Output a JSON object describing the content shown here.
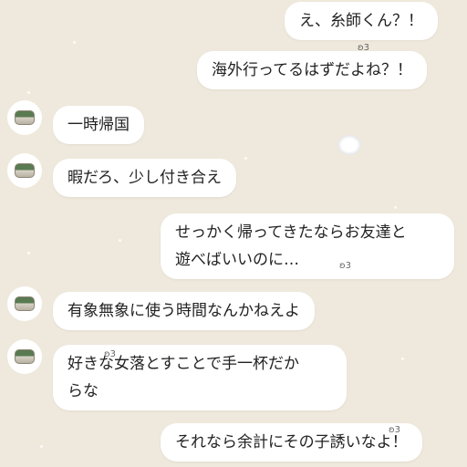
{
  "messages": [
    {
      "side": "right",
      "text": "え、糸師くん？！"
    },
    {
      "side": "right",
      "text": "海外行ってるはずだよね？！"
    },
    {
      "side": "left",
      "text": "一時帰国",
      "avatar": "matcha-cup-avatar"
    },
    {
      "side": "left",
      "text": "暇だろ、少し付き合え",
      "avatar": "matcha-cup-avatar"
    },
    {
      "side": "right",
      "line1": "せっかく帰ってきたならお友達と",
      "line2": "遊べばいいのに…"
    },
    {
      "side": "left",
      "text": "有象無象に使う時間なんかねえよ",
      "avatar": "matcha-cup-avatar"
    },
    {
      "side": "left",
      "line1": "好きな女落とすことで手一杯だか",
      "line2": "らな",
      "avatar": "matcha-cup-avatar"
    },
    {
      "side": "right",
      "text": "それなら余計にその子誘いなよ！"
    }
  ],
  "reactions": [
    "ʚ3",
    "ʚ3",
    "ʚ3",
    "ʚ3"
  ],
  "colors": {
    "background": "#efe9dd",
    "bubble": "#ffffff",
    "text": "#222222"
  }
}
